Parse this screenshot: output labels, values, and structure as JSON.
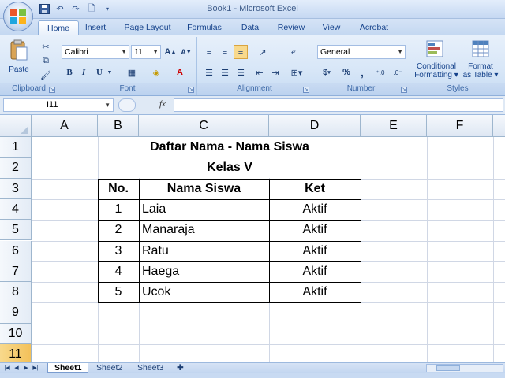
{
  "window": {
    "title": "Book1 - Microsoft Excel"
  },
  "tabs": [
    "Home",
    "Insert",
    "Page Layout",
    "Formulas",
    "Data",
    "Review",
    "View",
    "Acrobat"
  ],
  "ribbon": {
    "groups": {
      "clipboard": "Clipboard",
      "font": "Font",
      "alignment": "Alignment",
      "number": "Number",
      "styles": "Styles"
    },
    "paste_label": "Paste",
    "font_name": "Calibri",
    "font_size": "11",
    "number_format": "General",
    "conditional_formatting": [
      "Conditional",
      "Formatting ▾"
    ],
    "format_as_table": [
      "Format",
      "as Table ▾"
    ],
    "bold": "B",
    "italic": "I",
    "underline": "U",
    "currency": "$",
    "percent": "%",
    "comma": ",",
    "fx": "fx"
  },
  "namebox": {
    "value": "I11"
  },
  "grid": {
    "columns": [
      "A",
      "B",
      "C",
      "D",
      "E",
      "F"
    ],
    "rows": [
      "1",
      "2",
      "3",
      "4",
      "5",
      "6",
      "7",
      "8",
      "9",
      "10",
      "11"
    ],
    "selected_row": "11",
    "title": "Daftar Nama - Nama Siswa",
    "subtitle": "Kelas V",
    "headers": [
      "No.",
      "Nama Siswa",
      "Ket"
    ],
    "records": [
      {
        "no": "1",
        "name": "Laia",
        "ket": "Aktif"
      },
      {
        "no": "2",
        "name": "Manaraja",
        "ket": "Aktif"
      },
      {
        "no": "3",
        "name": "Ratu",
        "ket": "Aktif"
      },
      {
        "no": "4",
        "name": "Haega",
        "ket": "Aktif"
      },
      {
        "no": "5",
        "name": "Ucok",
        "ket": "Aktif"
      }
    ]
  },
  "sheets": [
    "Sheet1",
    "Sheet2",
    "Sheet3"
  ],
  "active_sheet": "Sheet1",
  "colors": {
    "ribbon_blue": "#d7e6f7",
    "row_selected": "#f3c15a"
  }
}
